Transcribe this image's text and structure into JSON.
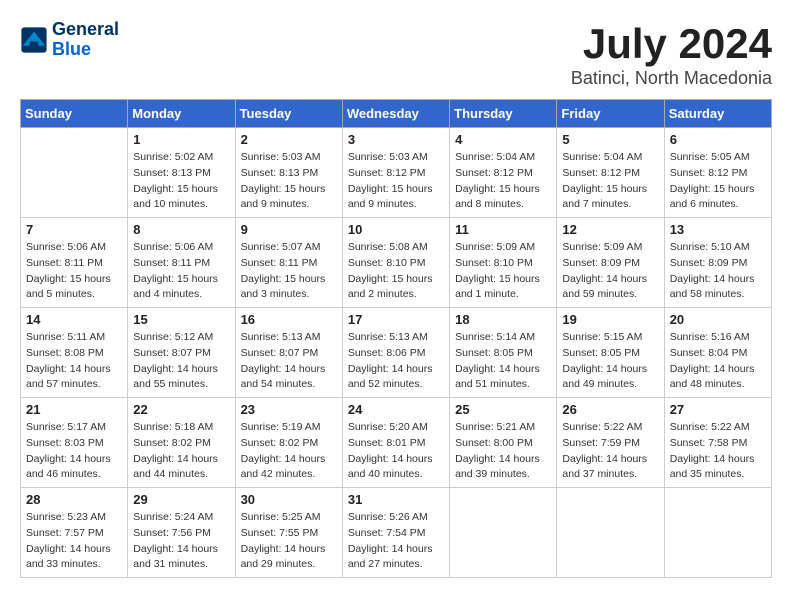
{
  "header": {
    "logo_line1": "General",
    "logo_line2": "Blue",
    "title": "July 2024",
    "subtitle": "Batinci, North Macedonia"
  },
  "days_of_week": [
    "Sunday",
    "Monday",
    "Tuesday",
    "Wednesday",
    "Thursday",
    "Friday",
    "Saturday"
  ],
  "weeks": [
    [
      {
        "day": "",
        "info": ""
      },
      {
        "day": "1",
        "info": "Sunrise: 5:02 AM\nSunset: 8:13 PM\nDaylight: 15 hours\nand 10 minutes."
      },
      {
        "day": "2",
        "info": "Sunrise: 5:03 AM\nSunset: 8:13 PM\nDaylight: 15 hours\nand 9 minutes."
      },
      {
        "day": "3",
        "info": "Sunrise: 5:03 AM\nSunset: 8:12 PM\nDaylight: 15 hours\nand 9 minutes."
      },
      {
        "day": "4",
        "info": "Sunrise: 5:04 AM\nSunset: 8:12 PM\nDaylight: 15 hours\nand 8 minutes."
      },
      {
        "day": "5",
        "info": "Sunrise: 5:04 AM\nSunset: 8:12 PM\nDaylight: 15 hours\nand 7 minutes."
      },
      {
        "day": "6",
        "info": "Sunrise: 5:05 AM\nSunset: 8:12 PM\nDaylight: 15 hours\nand 6 minutes."
      }
    ],
    [
      {
        "day": "7",
        "info": "Sunrise: 5:06 AM\nSunset: 8:11 PM\nDaylight: 15 hours\nand 5 minutes."
      },
      {
        "day": "8",
        "info": "Sunrise: 5:06 AM\nSunset: 8:11 PM\nDaylight: 15 hours\nand 4 minutes."
      },
      {
        "day": "9",
        "info": "Sunrise: 5:07 AM\nSunset: 8:11 PM\nDaylight: 15 hours\nand 3 minutes."
      },
      {
        "day": "10",
        "info": "Sunrise: 5:08 AM\nSunset: 8:10 PM\nDaylight: 15 hours\nand 2 minutes."
      },
      {
        "day": "11",
        "info": "Sunrise: 5:09 AM\nSunset: 8:10 PM\nDaylight: 15 hours\nand 1 minute."
      },
      {
        "day": "12",
        "info": "Sunrise: 5:09 AM\nSunset: 8:09 PM\nDaylight: 14 hours\nand 59 minutes."
      },
      {
        "day": "13",
        "info": "Sunrise: 5:10 AM\nSunset: 8:09 PM\nDaylight: 14 hours\nand 58 minutes."
      }
    ],
    [
      {
        "day": "14",
        "info": "Sunrise: 5:11 AM\nSunset: 8:08 PM\nDaylight: 14 hours\nand 57 minutes."
      },
      {
        "day": "15",
        "info": "Sunrise: 5:12 AM\nSunset: 8:07 PM\nDaylight: 14 hours\nand 55 minutes."
      },
      {
        "day": "16",
        "info": "Sunrise: 5:13 AM\nSunset: 8:07 PM\nDaylight: 14 hours\nand 54 minutes."
      },
      {
        "day": "17",
        "info": "Sunrise: 5:13 AM\nSunset: 8:06 PM\nDaylight: 14 hours\nand 52 minutes."
      },
      {
        "day": "18",
        "info": "Sunrise: 5:14 AM\nSunset: 8:05 PM\nDaylight: 14 hours\nand 51 minutes."
      },
      {
        "day": "19",
        "info": "Sunrise: 5:15 AM\nSunset: 8:05 PM\nDaylight: 14 hours\nand 49 minutes."
      },
      {
        "day": "20",
        "info": "Sunrise: 5:16 AM\nSunset: 8:04 PM\nDaylight: 14 hours\nand 48 minutes."
      }
    ],
    [
      {
        "day": "21",
        "info": "Sunrise: 5:17 AM\nSunset: 8:03 PM\nDaylight: 14 hours\nand 46 minutes."
      },
      {
        "day": "22",
        "info": "Sunrise: 5:18 AM\nSunset: 8:02 PM\nDaylight: 14 hours\nand 44 minutes."
      },
      {
        "day": "23",
        "info": "Sunrise: 5:19 AM\nSunset: 8:02 PM\nDaylight: 14 hours\nand 42 minutes."
      },
      {
        "day": "24",
        "info": "Sunrise: 5:20 AM\nSunset: 8:01 PM\nDaylight: 14 hours\nand 40 minutes."
      },
      {
        "day": "25",
        "info": "Sunrise: 5:21 AM\nSunset: 8:00 PM\nDaylight: 14 hours\nand 39 minutes."
      },
      {
        "day": "26",
        "info": "Sunrise: 5:22 AM\nSunset: 7:59 PM\nDaylight: 14 hours\nand 37 minutes."
      },
      {
        "day": "27",
        "info": "Sunrise: 5:22 AM\nSunset: 7:58 PM\nDaylight: 14 hours\nand 35 minutes."
      }
    ],
    [
      {
        "day": "28",
        "info": "Sunrise: 5:23 AM\nSunset: 7:57 PM\nDaylight: 14 hours\nand 33 minutes."
      },
      {
        "day": "29",
        "info": "Sunrise: 5:24 AM\nSunset: 7:56 PM\nDaylight: 14 hours\nand 31 minutes."
      },
      {
        "day": "30",
        "info": "Sunrise: 5:25 AM\nSunset: 7:55 PM\nDaylight: 14 hours\nand 29 minutes."
      },
      {
        "day": "31",
        "info": "Sunrise: 5:26 AM\nSunset: 7:54 PM\nDaylight: 14 hours\nand 27 minutes."
      },
      {
        "day": "",
        "info": ""
      },
      {
        "day": "",
        "info": ""
      },
      {
        "day": "",
        "info": ""
      }
    ]
  ]
}
